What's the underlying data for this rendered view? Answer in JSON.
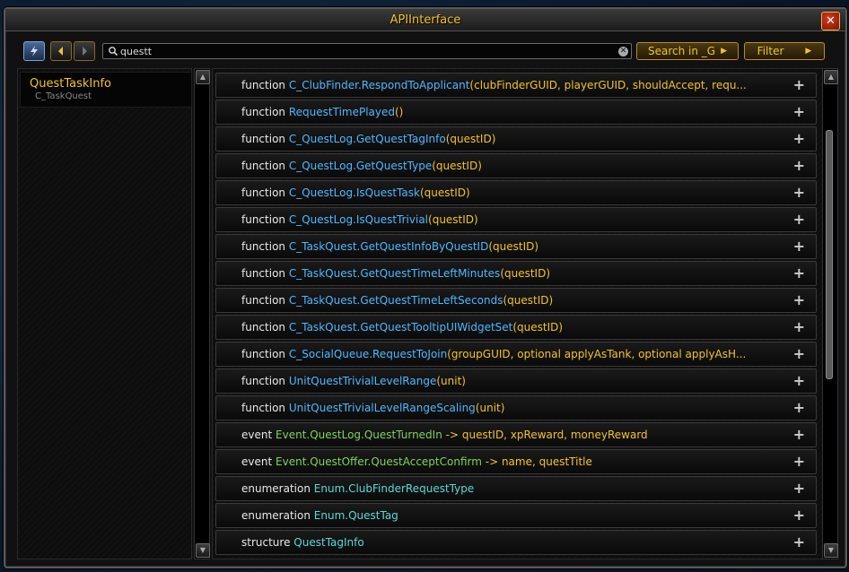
{
  "window": {
    "title": "APIInterface"
  },
  "toolbar": {
    "search_value": "questt",
    "search_in_label": "Search in _G",
    "filter_label": "Filter"
  },
  "left_panel": {
    "items": [
      {
        "title": "QuestTaskInfo",
        "subtitle": "C_TaskQuest"
      }
    ]
  },
  "results": [
    {
      "kind": "function",
      "name": "C_ClubFinder.RespondToApplicant",
      "args": "(clubFinderGUID, playerGUID, shouldAccept, requ...",
      "type": "fn"
    },
    {
      "kind": "function",
      "name": "RequestTimePlayed",
      "args": "()",
      "type": "fn2"
    },
    {
      "kind": "function",
      "name": "C_QuestLog.GetQuestTagInfo",
      "args": "(questID)",
      "type": "fn"
    },
    {
      "kind": "function",
      "name": "C_QuestLog.GetQuestType",
      "args": "(questID)",
      "type": "fn"
    },
    {
      "kind": "function",
      "name": "C_QuestLog.IsQuestTask",
      "args": "(questID)",
      "type": "fn"
    },
    {
      "kind": "function",
      "name": "C_QuestLog.IsQuestTrivial",
      "args": "(questID)",
      "type": "fn"
    },
    {
      "kind": "function",
      "name": "C_TaskQuest.GetQuestInfoByQuestID",
      "args": "(questID)",
      "type": "fn"
    },
    {
      "kind": "function",
      "name": "C_TaskQuest.GetQuestTimeLeftMinutes",
      "args": "(questID)",
      "type": "fn"
    },
    {
      "kind": "function",
      "name": "C_TaskQuest.GetQuestTimeLeftSeconds",
      "args": "(questID)",
      "type": "fn"
    },
    {
      "kind": "function",
      "name": "C_TaskQuest.GetQuestTooltipUIWidgetSet",
      "args": "(questID)",
      "type": "fn"
    },
    {
      "kind": "function",
      "name": "C_SocialQueue.RequestToJoin",
      "args": "(groupGUID, optional applyAsTank, optional applyAsH...",
      "type": "fn"
    },
    {
      "kind": "function",
      "name": "UnitQuestTrivialLevelRange",
      "args": "(unit)",
      "type": "fn"
    },
    {
      "kind": "function",
      "name": "UnitQuestTrivialLevelRangeScaling",
      "args": "(unit)",
      "type": "fn"
    },
    {
      "kind": "event",
      "name": "Event.QuestLog.QuestTurnedIn",
      "args": " -> questID, xpReward, moneyReward",
      "type": "ev"
    },
    {
      "kind": "event",
      "name": "Event.QuestOffer.QuestAcceptConfirm",
      "args": " -> name, questTitle",
      "type": "ev"
    },
    {
      "kind": "enumeration",
      "name": "Enum.ClubFinderRequestType",
      "args": "",
      "type": "en"
    },
    {
      "kind": "enumeration",
      "name": "Enum.QuestTag",
      "args": "",
      "type": "en"
    },
    {
      "kind": "structure",
      "name": "QuestTagInfo",
      "args": "",
      "type": "st"
    }
  ],
  "icons": {
    "close": "close-icon",
    "bolt": "lightning-icon",
    "back": "arrow-left-icon",
    "forward": "arrow-right-icon",
    "search": "search-icon",
    "clear": "clear-icon",
    "expand": "plus-icon"
  },
  "colors": {
    "title": "#f4c229",
    "keyword": "#e8e8e8",
    "function_name": "#4fb7ff",
    "event_name": "#7dd35b",
    "enum_name": "#5fd7d7",
    "args": "#f4c229"
  }
}
